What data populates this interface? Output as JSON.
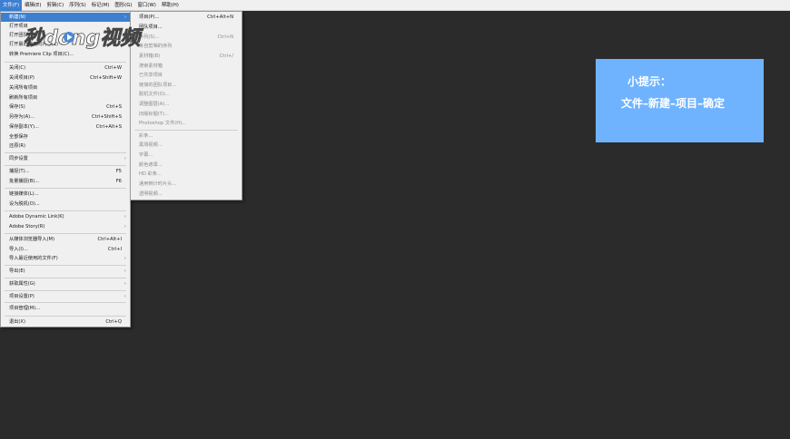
{
  "menubar": {
    "items": [
      "文件(F)",
      "编辑(E)",
      "剪辑(C)",
      "序列(S)",
      "标记(M)",
      "图形(G)",
      "窗口(W)",
      "帮助(H)"
    ]
  },
  "file_menu": {
    "items": [
      {
        "label": "新建(N)",
        "shortcut": "",
        "submenu": true,
        "highlighted": true
      },
      {
        "label": "打开项目",
        "shortcut": "",
        "submenu": false
      },
      {
        "label": "打开团队",
        "shortcut": "",
        "submenu": false
      },
      {
        "label": "打开最近使用的内容(E)",
        "shortcut": "",
        "submenu": true
      },
      {
        "label": "转换 Premiere Clip 项目(C)...",
        "shortcut": "",
        "submenu": false
      },
      {
        "label": "关闭(C)",
        "shortcut": "Ctrl+W",
        "submenu": false
      },
      {
        "label": "关闭项目(P)",
        "shortcut": "Ctrl+Shift+W",
        "submenu": false
      },
      {
        "label": "关闭所有项目",
        "shortcut": "",
        "submenu": false
      },
      {
        "label": "刷新所有项目",
        "shortcut": "",
        "submenu": false
      },
      {
        "label": "保存(S)",
        "shortcut": "Ctrl+S",
        "submenu": false
      },
      {
        "label": "另存为(A)...",
        "shortcut": "Ctrl+Shift+S",
        "submenu": false
      },
      {
        "label": "保存副本(Y)...",
        "shortcut": "Ctrl+Alt+S",
        "submenu": false
      },
      {
        "label": "全部保存",
        "shortcut": "",
        "submenu": false
      },
      {
        "label": "还原(R)",
        "shortcut": "",
        "submenu": false
      },
      {
        "label": "同步设置",
        "shortcut": "",
        "submenu": true
      },
      {
        "label": "捕捉(T)...",
        "shortcut": "F5",
        "submenu": false
      },
      {
        "label": "批量捕捉(B)...",
        "shortcut": "F6",
        "submenu": false
      },
      {
        "label": "链接媒体(L)...",
        "shortcut": "",
        "submenu": false
      },
      {
        "label": "设为脱机(O)...",
        "shortcut": "",
        "submenu": false
      },
      {
        "label": "Adobe Dynamic Link(K)",
        "shortcut": "",
        "submenu": true
      },
      {
        "label": "Adobe Story(R)",
        "shortcut": "",
        "submenu": true
      },
      {
        "label": "从媒体浏览器导入(M)",
        "shortcut": "Ctrl+Alt+I",
        "submenu": false
      },
      {
        "label": "导入(I)...",
        "shortcut": "Ctrl+I",
        "submenu": false
      },
      {
        "label": "导入最近使用的文件(F)",
        "shortcut": "",
        "submenu": true
      },
      {
        "label": "导出(E)",
        "shortcut": "",
        "submenu": true
      },
      {
        "label": "获取属性(G)",
        "shortcut": "",
        "submenu": true
      },
      {
        "label": "项目设置(P)",
        "shortcut": "",
        "submenu": true
      },
      {
        "label": "项目管理(M)...",
        "shortcut": "",
        "submenu": false
      },
      {
        "label": "退出(X)",
        "shortcut": "Ctrl+Q",
        "submenu": false
      }
    ]
  },
  "new_submenu": {
    "items": [
      {
        "label": "项目(P)...",
        "shortcut": "Ctrl+Alt+N",
        "disabled": false
      },
      {
        "label": "团队项目...",
        "shortcut": "",
        "disabled": false
      },
      {
        "label": "序列(S)...",
        "shortcut": "Ctrl+N",
        "disabled": true
      },
      {
        "label": "来自剪辑的序列",
        "shortcut": "",
        "disabled": true
      },
      {
        "label": "素材箱(B)",
        "shortcut": "Ctrl+/",
        "disabled": true
      },
      {
        "label": "搜索素材箱",
        "shortcut": "",
        "disabled": true
      },
      {
        "label": "已共享项目",
        "shortcut": "",
        "disabled": true
      },
      {
        "label": "链接的团队项目...",
        "shortcut": "",
        "disabled": true
      },
      {
        "label": "脱机文件(O)...",
        "shortcut": "",
        "disabled": true
      },
      {
        "label": "调整图层(A)...",
        "shortcut": "",
        "disabled": true
      },
      {
        "label": "旧版标题(T)...",
        "shortcut": "",
        "disabled": true
      },
      {
        "label": "Photoshop 文件(H)...",
        "shortcut": "",
        "disabled": true
      },
      {
        "label": "彩条...",
        "shortcut": "",
        "disabled": true
      },
      {
        "label": "黑场视频...",
        "shortcut": "",
        "disabled": true
      },
      {
        "label": "字幕...",
        "shortcut": "",
        "disabled": true
      },
      {
        "label": "颜色遮罩...",
        "shortcut": "",
        "disabled": true
      },
      {
        "label": "HD 彩条...",
        "shortcut": "",
        "disabled": true
      },
      {
        "label": "通用倒计时片头...",
        "shortcut": "",
        "disabled": true
      },
      {
        "label": "透明视频...",
        "shortcut": "",
        "disabled": true
      }
    ]
  },
  "watermark": {
    "text": "秒dong视频"
  },
  "tip": {
    "title": "小提示：",
    "body": "文件–新建–项目–确定"
  },
  "colors": {
    "background": "#2b2b2b",
    "menu_bg": "#f0f0f0",
    "highlight": "#3d7fd1",
    "tip_box": "#6fb3ff"
  }
}
